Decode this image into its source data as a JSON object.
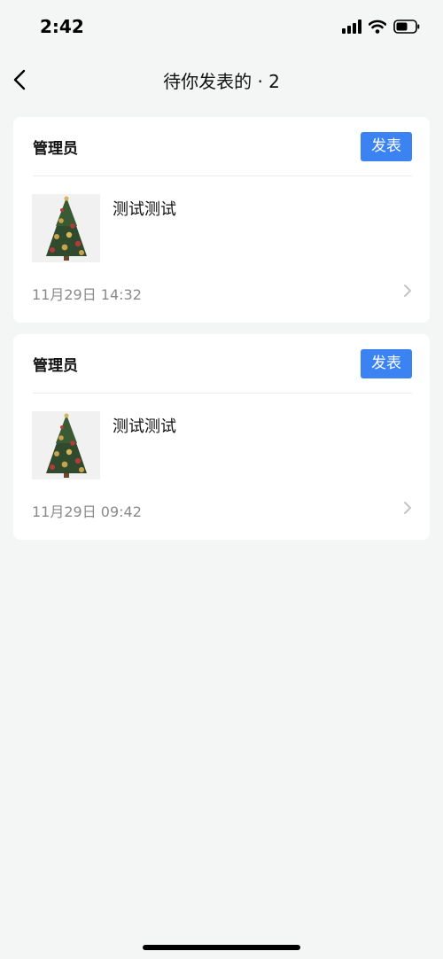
{
  "status_bar": {
    "time": "2:42"
  },
  "header": {
    "title": "待你发表的 · 2"
  },
  "posts": [
    {
      "author": "管理员",
      "publish_label": "发表",
      "title": "测试测试",
      "date": "11月29日 14:32"
    },
    {
      "author": "管理员",
      "publish_label": "发表",
      "title": "测试测试",
      "date": "11月29日 09:42"
    }
  ],
  "colors": {
    "accent": "#3b82f2",
    "background": "#f4f5f5",
    "card": "#ffffff",
    "muted_text": "#8a8a8a"
  },
  "icons": [
    "signal-icon",
    "wifi-icon",
    "battery-icon",
    "back-arrow-icon",
    "christmas-tree-thumbnail",
    "chevron-right-icon"
  ]
}
